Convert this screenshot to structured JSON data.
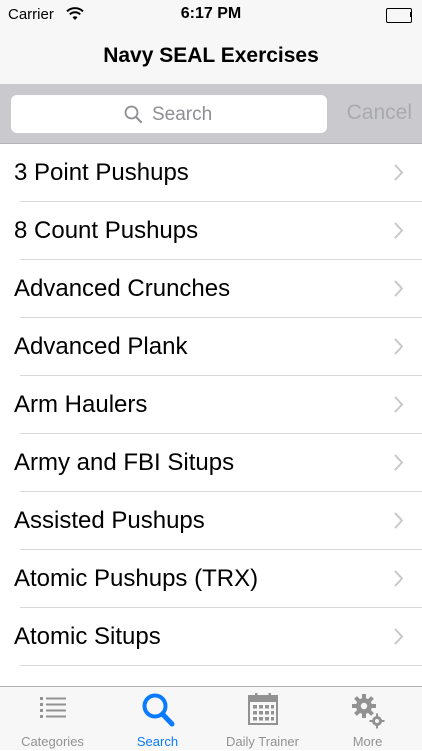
{
  "status_bar": {
    "carrier": "Carrier",
    "time": "6:17 PM"
  },
  "nav": {
    "title": "Navy SEAL Exercises"
  },
  "search": {
    "placeholder": "Search",
    "cancel_label": "Cancel"
  },
  "exercises": [
    "3 Point Pushups",
    "8 Count Pushups",
    "Advanced Crunches",
    "Advanced Plank",
    "Arm Haulers",
    "Army and FBI Situps",
    "Assisted Pushups",
    "Atomic Pushups (TRX)",
    "Atomic Situps"
  ],
  "tabs": [
    {
      "label": "Categories",
      "icon": "list-icon",
      "active": false
    },
    {
      "label": "Search",
      "icon": "search-icon",
      "active": true
    },
    {
      "label": "Daily Trainer",
      "icon": "calendar-icon",
      "active": false
    },
    {
      "label": "More",
      "icon": "gears-icon",
      "active": false
    }
  ],
  "colors": {
    "accent": "#0a7bff",
    "inactive": "#929292",
    "search_bg": "#c9c9ce"
  }
}
